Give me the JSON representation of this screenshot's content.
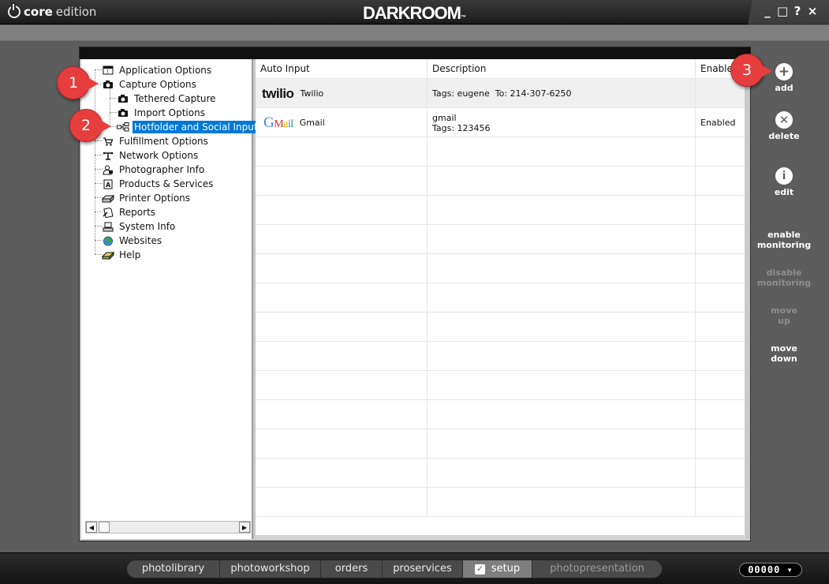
{
  "app": {
    "brand_core": "core",
    "brand_edition": "edition",
    "logo": "DARKROOM",
    "logo_tm": "™",
    "window_controls": [
      "_",
      "□",
      "?",
      "×"
    ]
  },
  "tree": {
    "items": [
      {
        "label": "Application Options",
        "icon": "app-options-icon"
      },
      {
        "label": "Capture Options",
        "icon": "camera-icon"
      },
      {
        "label": "Tethered Capture",
        "icon": "camera-icon"
      },
      {
        "label": "Import Options",
        "icon": "camera-icon"
      },
      {
        "label": "Hotfolder and Social Input",
        "icon": "hotfolder-icon",
        "selected": true
      },
      {
        "label": "Fulfillment Options",
        "icon": "cart-icon"
      },
      {
        "label": "Network Options",
        "icon": "network-icon"
      },
      {
        "label": "Photographer Info",
        "icon": "photographer-icon"
      },
      {
        "label": "Products & Services",
        "icon": "products-icon"
      },
      {
        "label": "Printer Options",
        "icon": "printer-icon"
      },
      {
        "label": "Reports",
        "icon": "reports-icon"
      },
      {
        "label": "System Info",
        "icon": "computer-icon"
      },
      {
        "label": "Websites",
        "icon": "globe-icon"
      },
      {
        "label": "Help",
        "icon": "book-icon"
      }
    ]
  },
  "table": {
    "headers": {
      "auto_input": "Auto Input",
      "description": "Description",
      "enabled": "Enable"
    },
    "rows": [
      {
        "logo": "twilio",
        "name": "Twilio",
        "desc_line1": "Tags: eugene  To: 214-307-6250",
        "desc_line2": "",
        "enabled": ""
      },
      {
        "logo": "gmail",
        "name": "Gmail",
        "desc_line1": "gmail",
        "desc_line2": "Tags: 123456",
        "enabled": "Enabled"
      }
    ]
  },
  "toolbar": {
    "add": "add",
    "delete": "delete",
    "edit": "edit",
    "enable_monitoring_1": "enable",
    "enable_monitoring_2": "monitoring",
    "disable_monitoring_1": "disable",
    "disable_monitoring_2": "monitoring",
    "move_up_1": "move",
    "move_up_2": "up",
    "move_down_1": "move",
    "move_down_2": "down"
  },
  "callouts": [
    "1",
    "2",
    "3"
  ],
  "nav": {
    "tabs": [
      "photolibrary",
      "photoworkshop",
      "orders",
      "proservices",
      "setup",
      "photopresentation"
    ],
    "active": "setup"
  },
  "counter": "00000 ▾",
  "colors": {
    "selection": "#0078d7",
    "callout": "#e63e3e",
    "twilio_red": "#f22f46"
  }
}
